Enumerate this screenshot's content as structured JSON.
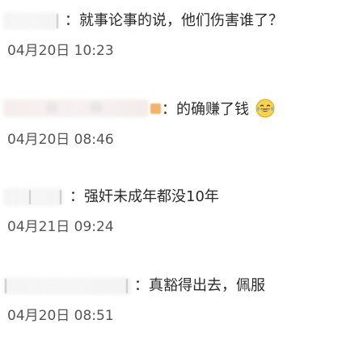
{
  "comments": [
    {
      "text": "：就事论事的说，他们伤害谁了？",
      "time": "04月20日 10:23"
    },
    {
      "text": "：的确赚了钱",
      "emoji": "laughing-with-tears-icon",
      "time": "04月20日 08:46"
    },
    {
      "text": "：强奸未成年都没10年",
      "time": "04月21日 09:24"
    },
    {
      "text": "：真豁得出去，佩服",
      "time": "04月20日 08:51"
    }
  ]
}
